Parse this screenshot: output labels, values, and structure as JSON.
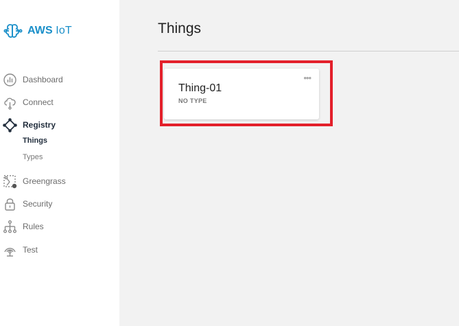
{
  "brand": {
    "name_bold": "AWS",
    "name_rest": "IoT",
    "logo_icon": "aws-iot-logo-icon",
    "color": "#1a8fc9"
  },
  "sidebar": {
    "items": [
      {
        "label": "Dashboard",
        "icon": "dashboard-icon"
      },
      {
        "label": "Connect",
        "icon": "cloud-connect-icon"
      },
      {
        "label": "Registry",
        "icon": "registry-icon",
        "active": true,
        "children": [
          {
            "label": "Things",
            "active": true
          },
          {
            "label": "Types"
          }
        ]
      },
      {
        "label": "Greengrass",
        "icon": "greengrass-icon"
      },
      {
        "label": "Security",
        "icon": "lock-icon"
      },
      {
        "label": "Rules",
        "icon": "rules-icon"
      },
      {
        "label": "Test",
        "icon": "test-broadcast-icon"
      }
    ]
  },
  "main": {
    "title": "Things",
    "cards": [
      {
        "name": "Thing-01",
        "type": "NO TYPE",
        "menu": "•••"
      }
    ]
  },
  "colors": {
    "highlight": "#e3202b",
    "background": "#f2f2f2",
    "sidebar": "#ffffff"
  }
}
